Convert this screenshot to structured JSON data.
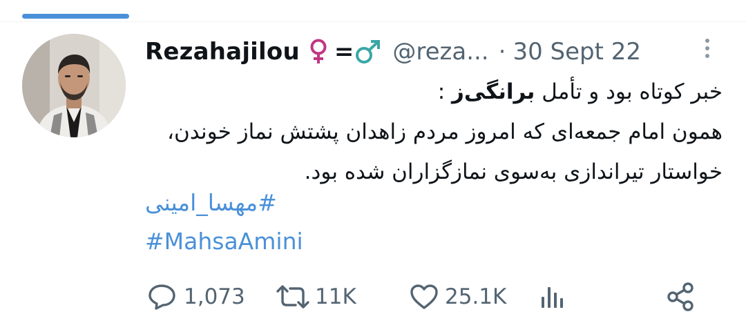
{
  "tweet": {
    "author": {
      "display_name": "Rezahajilou",
      "name_emoji": "♀ =♂",
      "handle": "@reza...",
      "separator": "·"
    },
    "timestamp": "30 Sept 22",
    "body": {
      "line1_prefix": "خبر کوتاه بود و تأمل ",
      "line1_bold": "برانگی‌ز",
      "line1_suffix": " :",
      "rest": "همون امام جمعه‌ای که امروز مردم زاهدان پشتش نماز خوندن، خواستار تیراندازی به‌سوی نمازگزاران شده بود."
    },
    "hashtags": [
      "#مهسا_امینی",
      "#MahsaAmini"
    ],
    "actions": {
      "replies": "1,073",
      "retweets": "11K",
      "likes": "25.1K"
    }
  },
  "icons": {
    "more": "more-vertical-icon",
    "reply": "reply-bubble-icon",
    "retweet": "retweet-icon",
    "like": "heart-icon",
    "views": "bar-chart-icon",
    "share": "share-icon"
  },
  "colors": {
    "link": "#4a90d9",
    "secondary_text": "#536471",
    "primary_text": "#0f1419",
    "female_sign": "#c13584",
    "male_sign": "#3aa6a6"
  }
}
